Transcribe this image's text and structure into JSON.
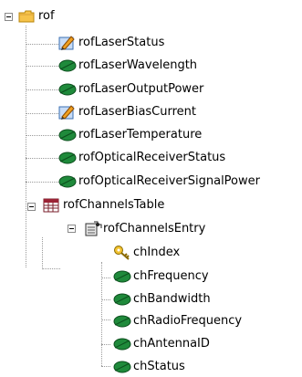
{
  "tree": {
    "root": {
      "label": "rof",
      "icon": "folder-icon"
    },
    "items": [
      {
        "label": "rofLaserStatus",
        "icon": "writable-leaf-icon"
      },
      {
        "label": "rofLaserWavelength",
        "icon": "leaf-icon"
      },
      {
        "label": "rofLaserOutputPower",
        "icon": "leaf-icon"
      },
      {
        "label": "rofLaserBiasCurrent",
        "icon": "writable-leaf-icon"
      },
      {
        "label": "rofLaserTemperature",
        "icon": "leaf-icon"
      },
      {
        "label": "rofOpticalReceiverStatus",
        "icon": "leaf-icon"
      },
      {
        "label": "rofOpticalReceiverSignalPower",
        "icon": "leaf-icon"
      }
    ],
    "table": {
      "label": "rofChannelsTable",
      "icon": "table-icon"
    },
    "entry": {
      "label": "rofChannelsEntry",
      "icon": "entry-icon"
    },
    "columns": [
      {
        "label": "chIndex",
        "icon": "key-icon"
      },
      {
        "label": "chFrequency",
        "icon": "leaf-icon"
      },
      {
        "label": "chBandwidth",
        "icon": "leaf-icon"
      },
      {
        "label": "chRadioFrequency",
        "icon": "leaf-icon"
      },
      {
        "label": "chAntennaID",
        "icon": "leaf-icon"
      },
      {
        "label": "chStatus",
        "icon": "leaf-icon"
      }
    ]
  }
}
